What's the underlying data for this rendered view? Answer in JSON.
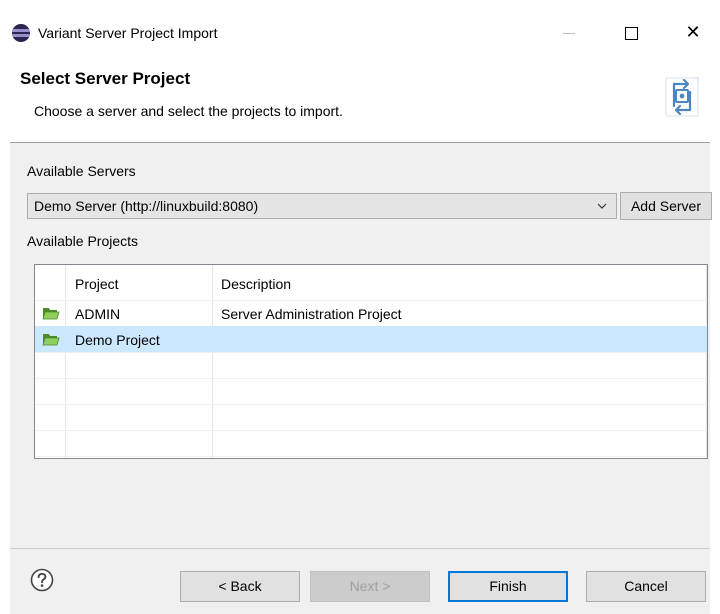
{
  "window": {
    "title": "Variant Server Project Import",
    "icon": "eclipse-icon",
    "controls": [
      "minimize-icon",
      "maximize-icon",
      "close-icon"
    ],
    "close_glyph": "✕"
  },
  "banner": {
    "title": "Select Server Project",
    "description": "Choose a server and select the projects to import.",
    "icon": "server-import-icon"
  },
  "servers": {
    "label": "Available Servers",
    "selected": "Demo Server (http://linuxbuild:8080)",
    "add_button": "Add Server"
  },
  "projects": {
    "label": "Available Projects",
    "columns": [
      "Project",
      "Description"
    ],
    "rows": [
      {
        "name": "ADMIN",
        "description": "Server Administration Project",
        "selected": false
      },
      {
        "name": "Demo Project",
        "description": "",
        "selected": true
      }
    ],
    "selection_color": "#cce8ff",
    "folder_color": "#6cad3f"
  },
  "footer": {
    "help_icon": "help-icon",
    "back": "< Back",
    "next": "Next >",
    "finish": "Finish",
    "cancel": "Cancel"
  },
  "colors": {
    "dialog_bg": "#f0f0f0",
    "default_button_border": "#0078d7"
  }
}
